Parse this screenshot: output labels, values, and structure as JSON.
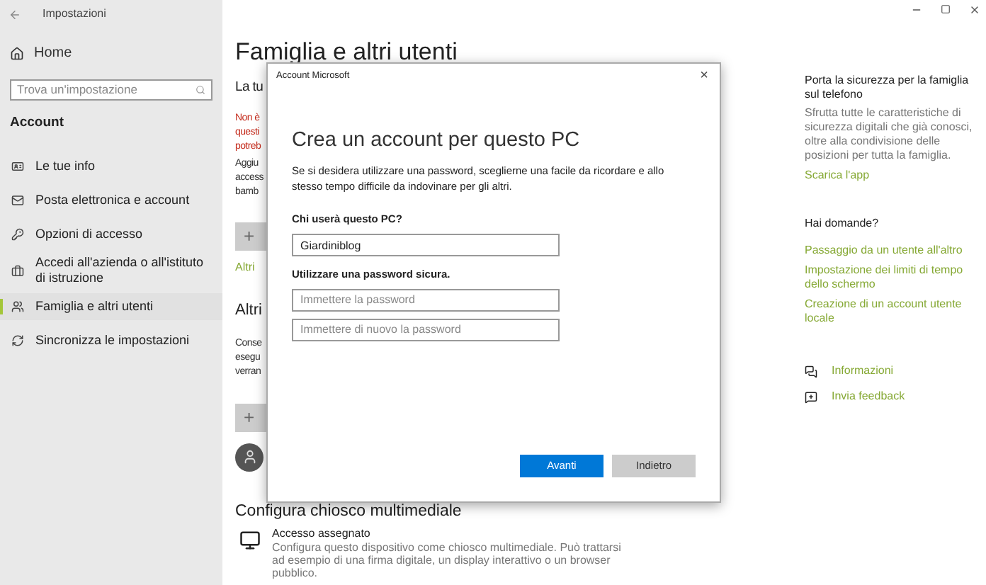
{
  "window": {
    "title": "Impostazioni"
  },
  "sidebar": {
    "home": "Home",
    "search": {
      "placeholder": "Trova un'impostazione"
    },
    "section": "Account",
    "items": [
      {
        "label": "Le tue info",
        "selected": false
      },
      {
        "label": "Posta elettronica e account",
        "selected": false
      },
      {
        "label": "Opzioni di accesso",
        "selected": false
      },
      {
        "label": "Accedi all'azienda o all'istituto di istruzione",
        "selected": false
      },
      {
        "label": "Famiglia e altri utenti",
        "selected": true
      },
      {
        "label": "Sincronizza le impostazioni",
        "selected": false
      }
    ]
  },
  "main": {
    "title": "Famiglia e altri utenti",
    "section_1": {
      "heading": "La tu",
      "lines": [
        {
          "text": "Non è",
          "kind": "warning"
        },
        {
          "text": "questi",
          "kind": "warning"
        },
        {
          "text": "potreb",
          "kind": "warning"
        },
        {
          "text": "Aggiu",
          "kind": "normal"
        },
        {
          "text": "access",
          "kind": "normal"
        },
        {
          "text": "bamb",
          "kind": "normal"
        }
      ],
      "add_button": "+",
      "link": "Altri"
    },
    "section_2": {
      "heading": "Altri",
      "lines": [
        "Conse",
        "esegu",
        "verran"
      ],
      "add_button": "+"
    },
    "section_3": {
      "heading": "Configura chiosco multimediale",
      "item_title": "Accesso assegnato",
      "item_description": "Configura questo dispositivo come chiosco multimediale. Può trattarsi ad esempio di una firma digitale, un display interattivo o un browser pubblico."
    }
  },
  "dialog": {
    "title": "Account Microsoft",
    "close": "×",
    "heading": "Crea un account per questo PC",
    "description": "Se si desidera utilizzare una password, sceglierne una facile da ricordare e allo stesso tempo difficile da indovinare per gli altri.",
    "user_label": "Chi userà questo PC?",
    "user_value": "Giardiniblog",
    "password_label": "Utilizzare una password sicura.",
    "password_placeholder": "Immettere la password",
    "confirm_placeholder": "Immettere di nuovo la password",
    "buttons": [
      {
        "label": "Avanti",
        "kind": "primary"
      },
      {
        "label": "Indietro",
        "kind": "secondary"
      }
    ]
  },
  "right_pane": {
    "promo_title": "Porta la sicurezza per la famiglia sul telefono",
    "promo_text": "Sfrutta tutte le caratteristiche di sicurezza digitali che già conosci, oltre alla condivisione delle posizioni per tutta la famiglia.",
    "promo_link": "Scarica l'app",
    "questions_title": "Hai domande?",
    "links": [
      "Passaggio da un utente all'altro",
      "Impostazione dei limiti di tempo dello schermo",
      "Creazione di un account utente locale"
    ],
    "help": [
      "Informazioni",
      "Invia feedback"
    ]
  }
}
